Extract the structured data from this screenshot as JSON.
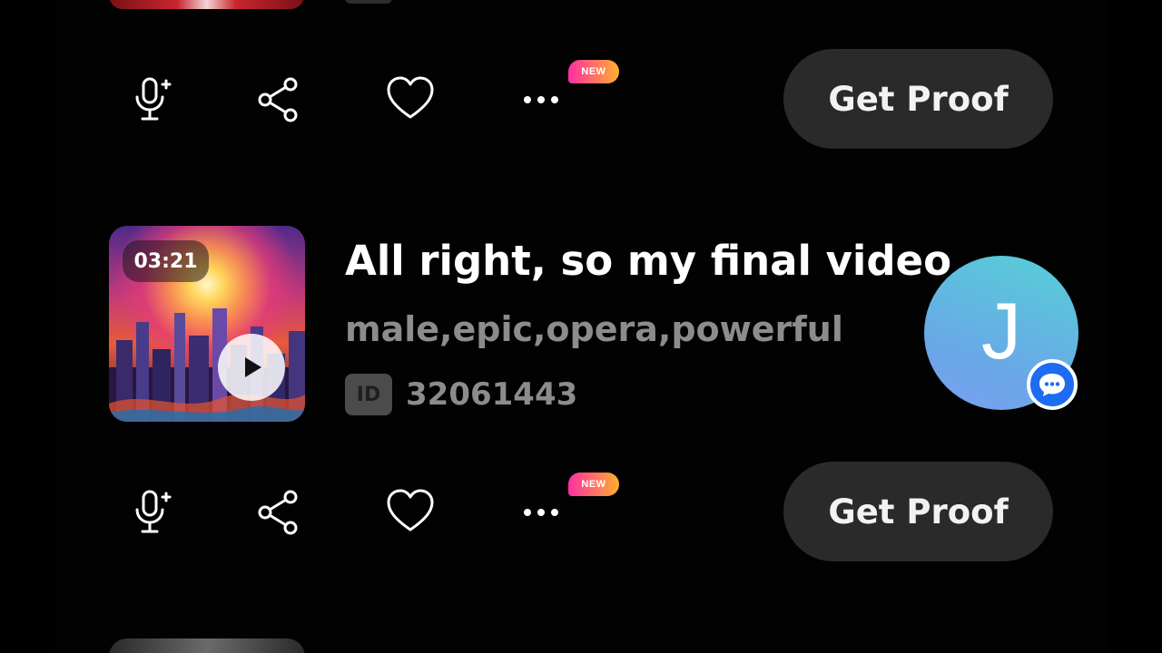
{
  "previous_item": {
    "actions": {
      "get_proof_label": "Get Proof",
      "new_badge": "NEW",
      "icons": [
        "mic-plus-icon",
        "share-icon",
        "heart-icon",
        "more-icon"
      ]
    }
  },
  "song": {
    "duration": "03:21",
    "title": "All right, so my final video",
    "tags": "male,epic,opera,powerful",
    "id_label": "ID",
    "id_value": "32061443",
    "actions": {
      "get_proof_label": "Get Proof",
      "new_badge": "NEW",
      "icons": [
        "mic-plus-icon",
        "share-icon",
        "heart-icon",
        "more-icon"
      ]
    }
  },
  "floating_avatar": {
    "letter": "J",
    "badge_icon": "chat-bubble-icon"
  },
  "colors": {
    "background": "#000000",
    "button_bg": "#2a2a2a",
    "muted_text": "#8c8c8c",
    "avatar_gradient": [
      "#56d0d6",
      "#7aa0f0"
    ],
    "chat_badge": "#1d6cf2",
    "new_badge_gradient": [
      "#ff2fa3",
      "#ffb02e"
    ]
  }
}
